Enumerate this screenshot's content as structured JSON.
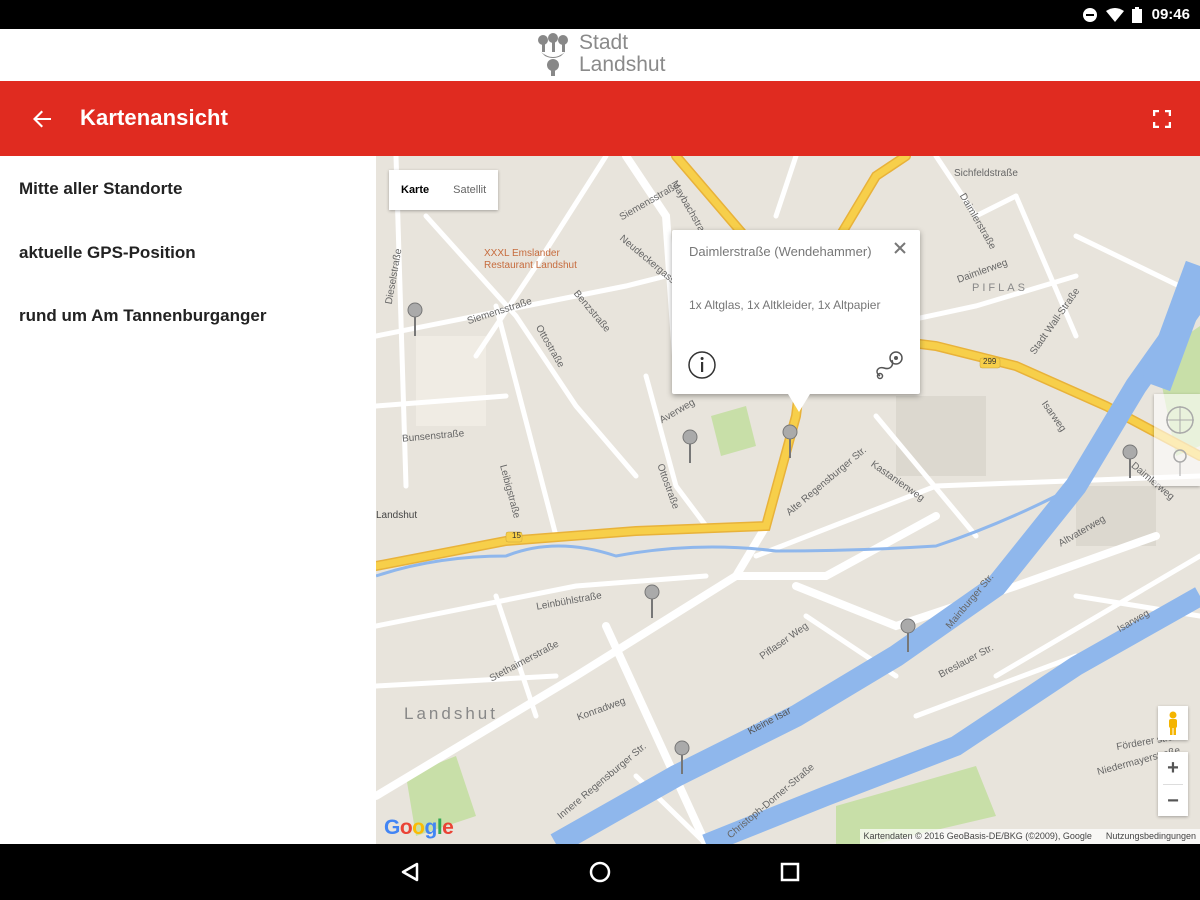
{
  "status_bar": {
    "time": "09:46"
  },
  "logo": {
    "line1": "Stadt",
    "line2": "Landshut"
  },
  "app_bar": {
    "title": "Kartenansicht"
  },
  "sidebar": {
    "items": [
      {
        "label": "Mitte aller Standorte"
      },
      {
        "label": "aktuelle GPS-Position"
      },
      {
        "label": "rund um Am Tannenburganger"
      }
    ]
  },
  "map": {
    "type_tabs": [
      {
        "label": "Karte",
        "active": true
      },
      {
        "label": "Satellit",
        "active": false
      }
    ],
    "info_window": {
      "title": "Daimlerstraße (Wendehammer)",
      "description": "1x Altglas, 1x Altkleider, 1x Altpapier"
    },
    "labels": {
      "poi": "XXXL Emslander Restaurant Landshut",
      "city": "Landshut",
      "city_small": "Landshut",
      "district": "PIFLAS",
      "river": "Kleine Isar",
      "road_number_15": "15",
      "road_number_299": "299",
      "streets": [
        "Siemensstraße",
        "Siemensstraße",
        "Ottostraße",
        "Benzstraße",
        "Neudeckergasse",
        "Bunsenstraße",
        "Leibigstraße",
        "Ottostraße",
        "Averweg",
        "Alte Regensburger Str.",
        "Kastanienweg",
        "Leinbühlstraße",
        "Stethaimerstraße",
        "Konradweg",
        "Piflaser Weg",
        "Innere Regensburger Str.",
        "Christoph-Dorner-Straße",
        "Breslauer Str.",
        "Mainburger Str.",
        "Isarweg",
        "Altvaterweg",
        "Daimlerweg",
        "Förderer straße",
        "Niedermayerstraße",
        "Sichfeldstraße",
        "Daimlerstraße",
        "Daimlerweg",
        "Stadt Wall-Straße",
        "Isarweg",
        "Dieselstraße",
        "Maybachstraße"
      ]
    },
    "attribution": "Kartendaten © 2016 GeoBasis-DE/BKG (©2009), Google",
    "terms": "Nutzungsbedingungen",
    "google": "Google",
    "zoom_in": "+",
    "zoom_out": "−"
  },
  "colors": {
    "accent": "#e02b20",
    "map_background": "#e8e4dc",
    "water": "#8fb7ec",
    "highway": "#f7cf4a",
    "park": "#c8dfa8"
  }
}
